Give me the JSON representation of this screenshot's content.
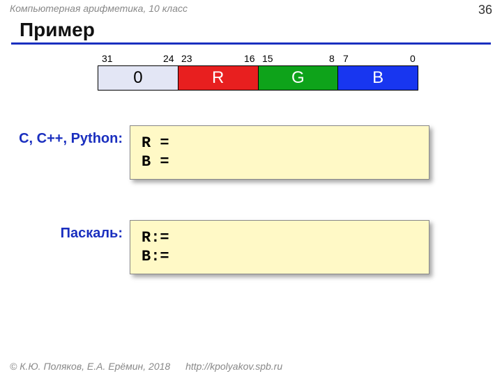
{
  "header": {
    "course": "Компьютерная арифметика, 10 класс",
    "page": "36"
  },
  "title": "Пример",
  "bits": {
    "b31": "31",
    "b24": "24",
    "b23": "23",
    "b16": "16",
    "b15": "15",
    "b8": "8",
    "b7": "7",
    "b0": "0"
  },
  "segments": {
    "zero": "0",
    "r": "R",
    "g": "G",
    "b": "B"
  },
  "lang1": {
    "label": "C, C++, Python:",
    "line1": "R =",
    "line2": "B ="
  },
  "lang2": {
    "label": "Паскаль:",
    "line1": "R:=",
    "line2": "B:="
  },
  "footer": {
    "copyright": "© К.Ю. Поляков, Е.А. Ерёмин, 2018",
    "url": "http://kpolyakov.spb.ru"
  }
}
